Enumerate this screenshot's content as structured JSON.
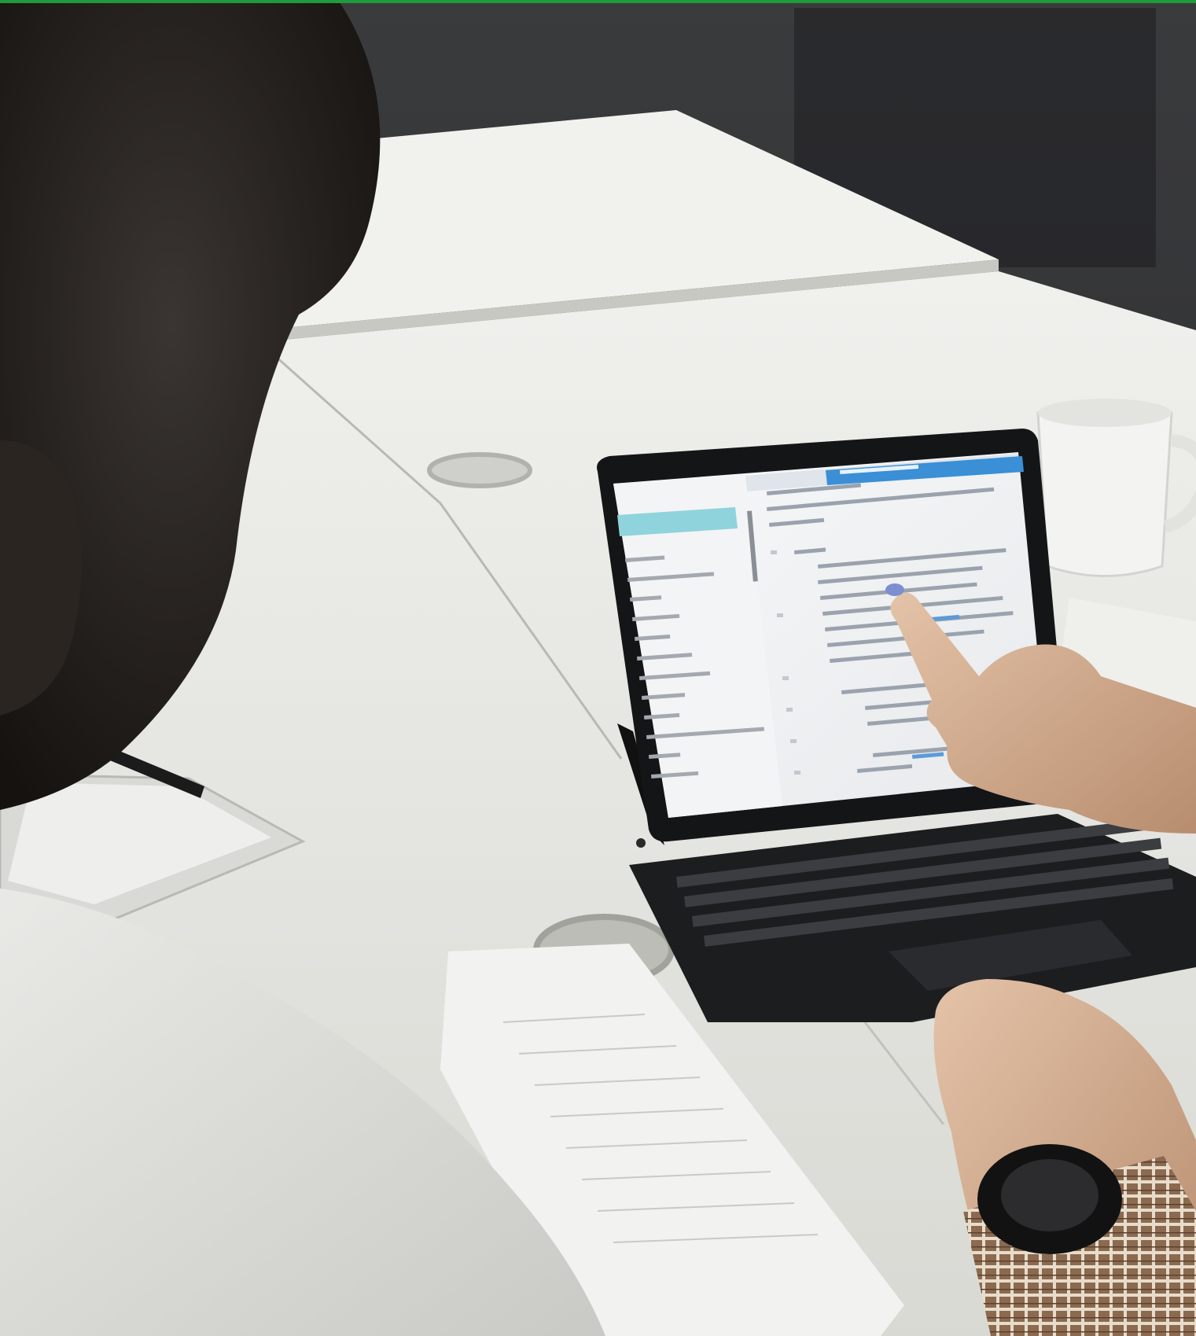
{
  "colors": {
    "top_accent": "#1f9a3c",
    "background_wall": "#2e2f31",
    "desk": "#e6e6e2",
    "tablet_bezel": "#141516",
    "editor_tab_active": "#3a8fd6",
    "sidebar_highlight": "#8fd3dc",
    "keyboard": "#1c1d1f"
  },
  "icons": {
    "tablet_power": "circle-icon"
  }
}
